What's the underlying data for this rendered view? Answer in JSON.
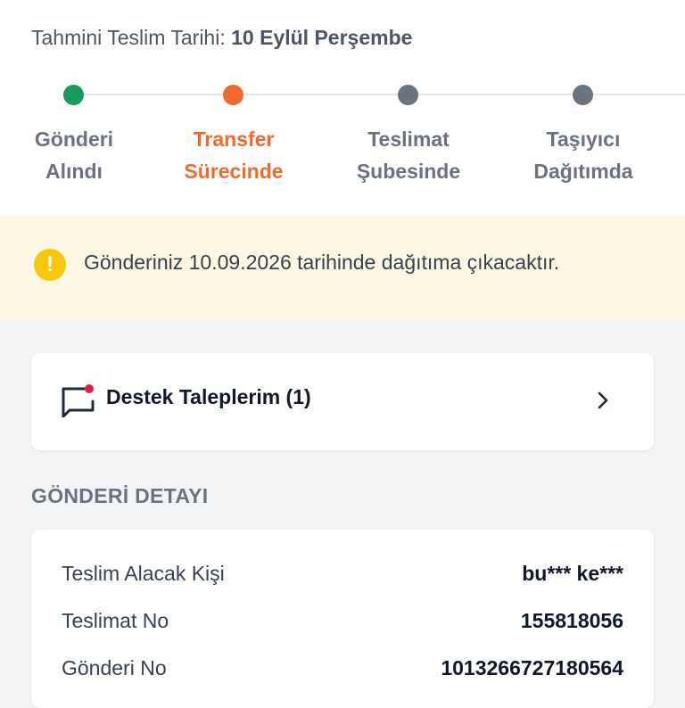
{
  "header": {
    "eta_label": "Tahmini Teslim Tarihi:",
    "eta_value": "10 Eylül Perşembe"
  },
  "tracking": {
    "steps": [
      {
        "line1": "Gönderi",
        "line2": "Alındı",
        "state": "completed",
        "color": "#1a9a5b"
      },
      {
        "line1": "Transfer",
        "line2": "Sürecinde",
        "state": "active",
        "color": "#f2692e"
      },
      {
        "line1": "Teslimat",
        "line2": "Şubesinde",
        "state": "pending",
        "color": "#6b7280"
      },
      {
        "line1": "Taşıyıcı",
        "line2": "Dağıtımda",
        "state": "pending",
        "color": "#6b7280"
      }
    ]
  },
  "notice": {
    "icon": "exclamation-icon",
    "icon_text": "!",
    "text": "Gönderiniz 10.09.2026 tarihinde dağıtıma çıkacaktır.",
    "icon_color": "#f8c80d"
  },
  "support": {
    "label": "Destek Taleplerim (1)",
    "icon": "message-badge-icon",
    "chevron": "chevron-right-icon"
  },
  "details": {
    "section_title": "GÖNDERİ DETAYI",
    "rows": [
      {
        "label": "Teslim Alacak Kişi",
        "value": "bu*** ke***"
      },
      {
        "label": "Teslimat No",
        "value": "155818056"
      },
      {
        "label": "Gönderi No",
        "value": "1013266727180564"
      }
    ]
  },
  "colors": {
    "accent": "#f2692e",
    "completed": "#1a9a5b",
    "pending": "#6b7280",
    "notice_bg": "#fdf8e4",
    "badge": "#e11d48"
  }
}
